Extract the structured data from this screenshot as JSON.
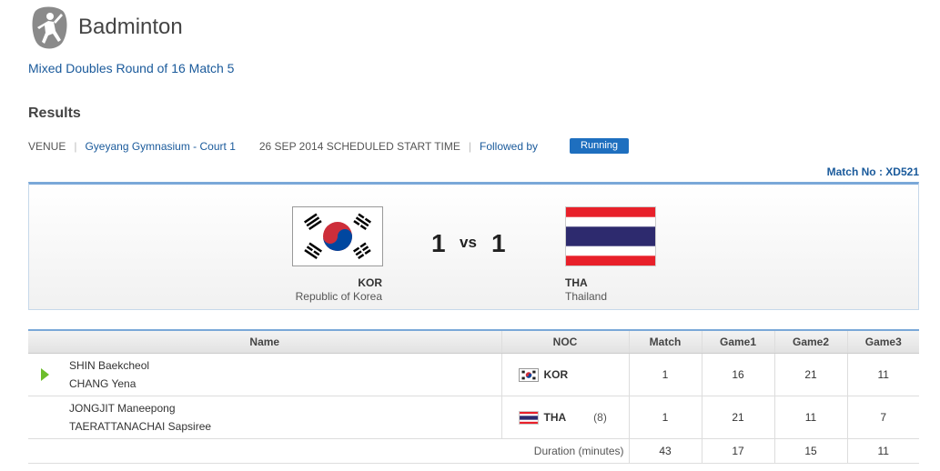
{
  "header": {
    "sport_icon": "badminton-player-icon",
    "sport_title": "Badminton",
    "event_name": "Mixed Doubles Round of 16 Match 5"
  },
  "results": {
    "section_title": "Results",
    "venue_label": "VENUE",
    "venue": "Gyeyang Gymnasium - Court 1",
    "date_label": "26 SEP 2014 SCHEDULED START TIME",
    "followed_by": "Followed by",
    "status": "Running",
    "match_no": "Match No : XD521"
  },
  "scoreboard": {
    "home": {
      "code": "KOR",
      "name": "Republic of Korea",
      "score": "1",
      "flag": "korea-flag"
    },
    "vs": "vs",
    "away": {
      "code": "THA",
      "name": "Thailand",
      "score": "1",
      "flag": "thailand-flag"
    }
  },
  "table": {
    "headers": [
      "Name",
      "NOC",
      "Match",
      "Game1",
      "Game2",
      "Game3"
    ],
    "rows": [
      {
        "players": [
          "SHIN Baekcheol",
          "CHANG Yena"
        ],
        "noc": "KOR",
        "seed": "",
        "match": "1",
        "game1": "16",
        "game2": "21",
        "game3": "11",
        "winner": true
      },
      {
        "players": [
          "JONGJIT Maneepong",
          "TAERATTANACHAI Sapsiree"
        ],
        "noc": "THA",
        "seed": "(8)",
        "match": "1",
        "game1": "21",
        "game2": "11",
        "game3": "7",
        "winner": false
      }
    ],
    "duration": {
      "label": "Duration (minutes)",
      "match": "43",
      "game1": "17",
      "game2": "15",
      "game3": "11"
    }
  },
  "colors": {
    "link": "#1a5a9b",
    "badge": "#1e6fbf",
    "accent_border": "#7aa8d8",
    "win_arrow": "#6cbd2b",
    "kor_red": "#cd2e3a",
    "kor_blue": "#0047a0",
    "tha_red": "#e8202a",
    "tha_blue": "#2d2a6e"
  }
}
